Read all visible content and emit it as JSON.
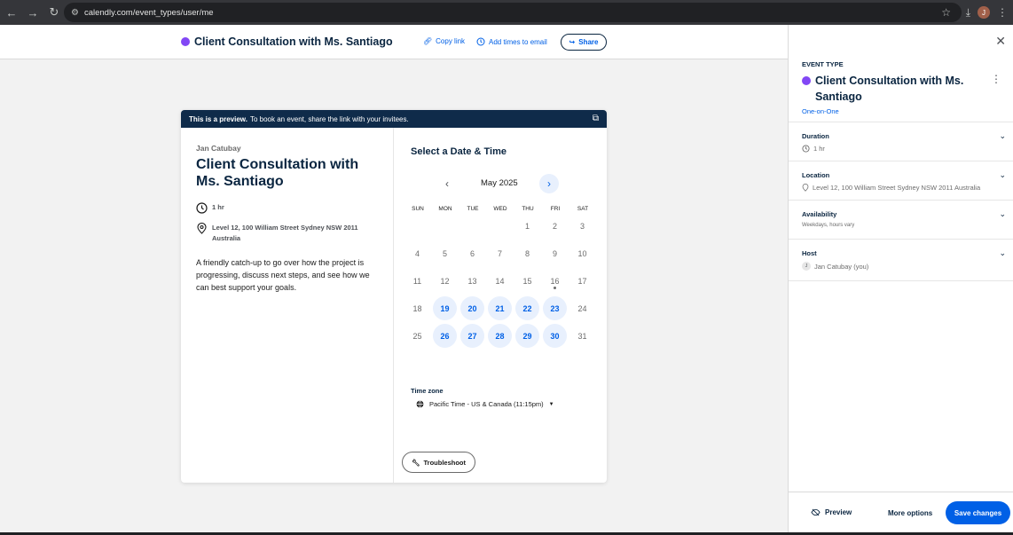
{
  "browser": {
    "url": "calendly.com/event_types/user/me",
    "avatar_initial": "J"
  },
  "topbar": {
    "title": "Client Consultation with Ms. Santiago",
    "copy_link": "Copy link",
    "add_times": "Add times to email",
    "share": "Share"
  },
  "colors": {
    "event_dot": "#8247f5",
    "accent": "#0060e6",
    "banner": "#0f2b4a"
  },
  "preview": {
    "banner_bold": "This is a preview.",
    "banner_text": "To book an event, share the link with your invitees.",
    "host": "Jan Catubay",
    "title": "Client Consultation with Ms. Santiago",
    "duration": "1 hr",
    "location": "Level 12, 100 William Street Sydney NSW 2011 Australia",
    "description": "A friendly catch-up to go over how the project is progressing, discuss next steps, and see how we can best support your goals.",
    "select_title": "Select a Date & Time",
    "month": "May 2025",
    "weekdays": [
      "SUN",
      "MON",
      "TUE",
      "WED",
      "THU",
      "FRI",
      "SAT"
    ],
    "weeks": [
      [
        "",
        "",
        "",
        "",
        "1",
        "2",
        "3"
      ],
      [
        "4",
        "5",
        "6",
        "7",
        "8",
        "9",
        "10"
      ],
      [
        "11",
        "12",
        "13",
        "14",
        "15",
        "16",
        "17"
      ],
      [
        "18",
        "19",
        "20",
        "21",
        "22",
        "23",
        "24"
      ],
      [
        "25",
        "26",
        "27",
        "28",
        "29",
        "30",
        "31"
      ]
    ],
    "available_days": [
      "19",
      "20",
      "21",
      "22",
      "23",
      "26",
      "27",
      "28",
      "29",
      "30"
    ],
    "today": "16",
    "timezone_label": "Time zone",
    "timezone_value": "Pacific Time - US & Canada (11:15pm)",
    "troubleshoot": "Troubleshoot"
  },
  "panel": {
    "section_label": "EVENT TYPE",
    "title": "Client Consultation with Ms. Santiago",
    "type": "One-on-One",
    "duration_label": "Duration",
    "duration_value": "1 hr",
    "location_label": "Location",
    "location_value": "Level 12, 100 William Street Sydney NSW 2011 Australia",
    "availability_label": "Availability",
    "availability_value": "Weekdays, hours vary",
    "host_label": "Host",
    "host_value": "Jan Catubay (you)",
    "preview_btn": "Preview",
    "more_options": "More options",
    "save_changes": "Save changes"
  }
}
